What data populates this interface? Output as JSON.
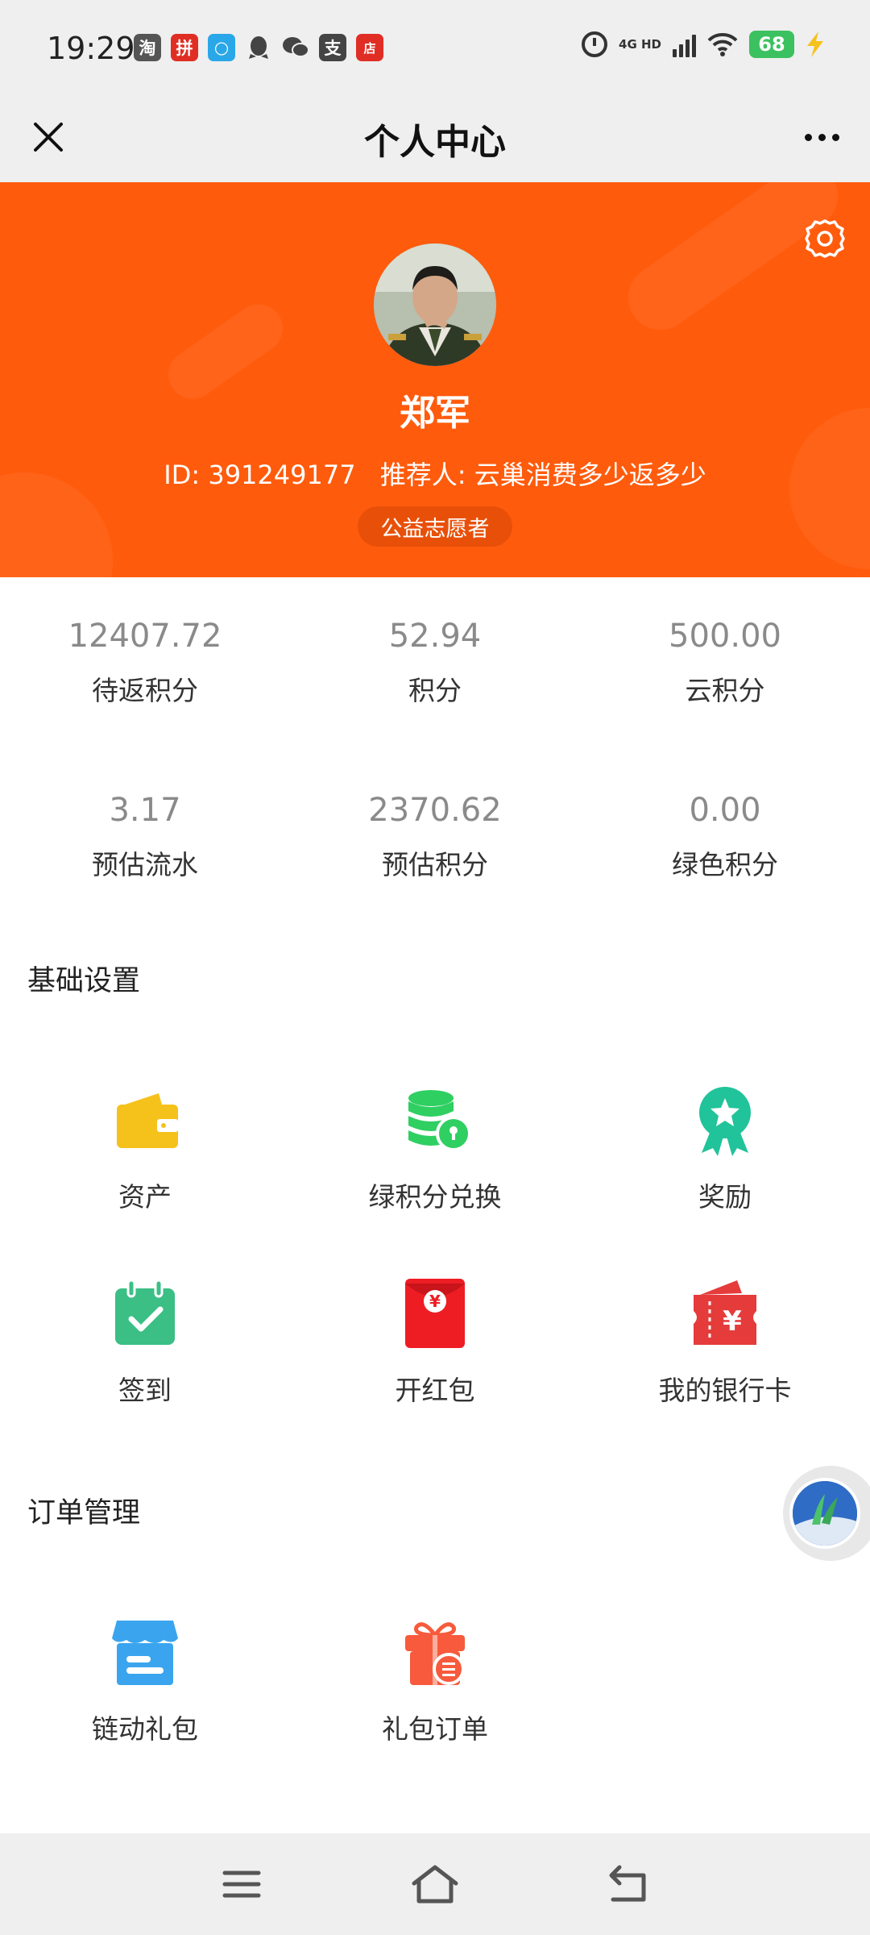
{
  "status_bar": {
    "time": "19:29",
    "apps": [
      {
        "icon": "taobao-icon",
        "glyph": "淘",
        "color": "#555555"
      },
      {
        "icon": "pinduoduo-icon",
        "glyph": "拼",
        "color": "#e02e24"
      },
      {
        "icon": "app-circle-icon",
        "glyph": "○",
        "color": "#2aa7e8"
      },
      {
        "icon": "qq-icon",
        "glyph": "◆",
        "color": "#444444"
      },
      {
        "icon": "wechat-icon",
        "glyph": "●",
        "color": "#444444"
      },
      {
        "icon": "alipay-icon",
        "glyph": "支",
        "color": "#444444"
      },
      {
        "icon": "shop-icon",
        "glyph": "店",
        "color": "#e02e24"
      }
    ],
    "network_top": "4G HD",
    "battery": "68"
  },
  "title_bar": {
    "title": "个人中心"
  },
  "profile": {
    "name": "郑军",
    "id_text": "ID: 391249177",
    "referrer_text": "推荐人: 云巢消费多少返多少",
    "badge": "公益志愿者"
  },
  "stats": [
    {
      "value": "12407.72",
      "label": "待返积分"
    },
    {
      "value": "52.94",
      "label": "积分"
    },
    {
      "value": "500.00",
      "label": "云积分"
    },
    {
      "value": "3.17",
      "label": "预估流水"
    },
    {
      "value": "2370.62",
      "label": "预估积分"
    },
    {
      "value": "0.00",
      "label": "绿色积分"
    }
  ],
  "basic_settings": {
    "title": "基础设置",
    "items": [
      {
        "label": "资产",
        "icon": "wallet-icon"
      },
      {
        "label": "绿积分兑换",
        "icon": "coins-exchange-icon"
      },
      {
        "label": "奖励",
        "icon": "award-ribbon-icon"
      },
      {
        "label": "签到",
        "icon": "calendar-check-icon"
      },
      {
        "label": "开红包",
        "icon": "red-envelope-icon"
      },
      {
        "label": "我的银行卡",
        "icon": "bank-card-ticket-icon"
      }
    ]
  },
  "order_management": {
    "title": "订单管理",
    "items": [
      {
        "label": "链动礼包",
        "icon": "store-icon"
      },
      {
        "label": "礼包订单",
        "icon": "gift-order-icon"
      }
    ]
  },
  "colors": {
    "banner": "#ff5b0c",
    "wallet": "#f5c21b",
    "green": "#2fcf62",
    "teal": "#21c39a",
    "calendar": "#3bbf85",
    "red": "#ee1d24",
    "blue": "#3aa5ee",
    "gift": "#f75a3c"
  }
}
